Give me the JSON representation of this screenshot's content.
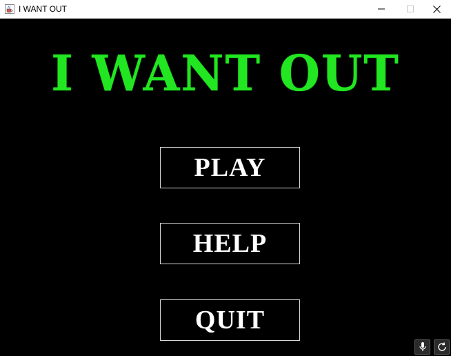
{
  "window": {
    "title": "I WANT OUT"
  },
  "game": {
    "title": "I WANT OUT",
    "title_color": "#22e622",
    "buttons": {
      "play": "PLAY",
      "help": "HELP",
      "quit": "QUIT"
    }
  },
  "icons": {
    "app": "java-cup-icon",
    "minimize": "minimize-icon",
    "maximize": "maximize-icon",
    "close": "close-icon",
    "mic": "microphone-icon",
    "refresh": "refresh-icon"
  }
}
